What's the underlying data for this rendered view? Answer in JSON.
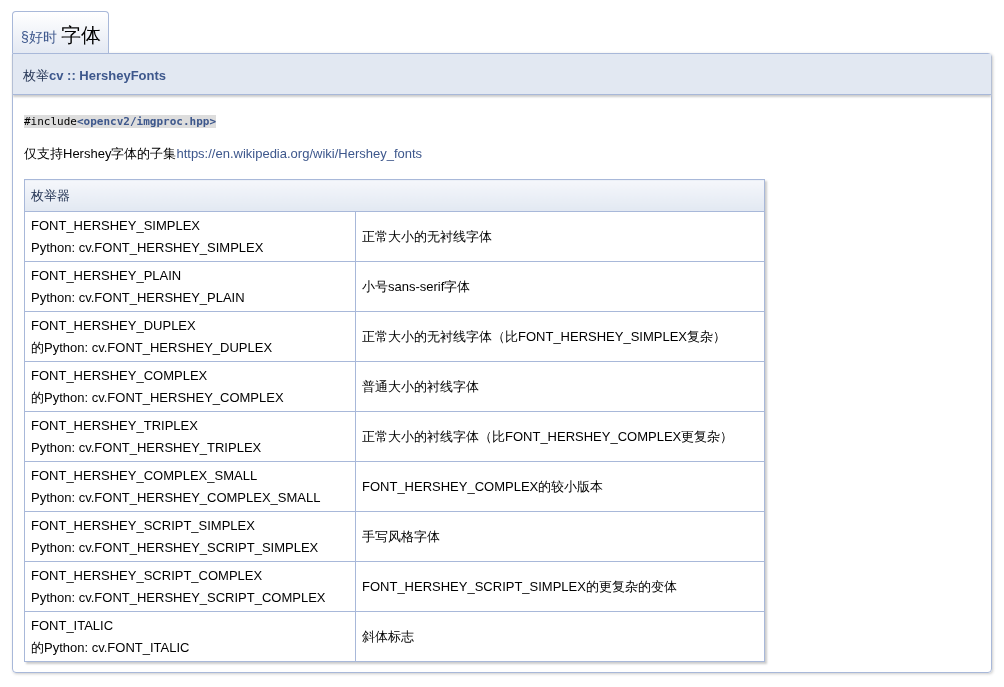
{
  "tab": {
    "prefix": "§好时",
    "title": "字体",
    "selected": true
  },
  "header": {
    "title": "枚举**cv :: HersheyFonts**"
  },
  "include": {
    "directive": "#include ",
    "file": "<opencv2/imgproc.hpp>"
  },
  "description": {
    "text": "仅支持Hershey字体的子集",
    "link": "https://en.wikipedia.org/wiki/Hershey_fonts"
  },
  "table": {
    "heading": "枚举器",
    "rows": [
      {
        "name": "FONT_HERSHEY_SIMPLEX",
        "python": "Python: cv.FONT_HERSHEY_SIMPLEX",
        "description": "正常大小的无衬线字体"
      },
      {
        "name": "FONT_HERSHEY_PLAIN",
        "python": "Python: cv.FONT_HERSHEY_PLAIN",
        "description": "小号sans-serif字体"
      },
      {
        "name": "FONT_HERSHEY_DUPLEX",
        "python": "的Python: cv.FONT_HERSHEY_DUPLEX",
        "description": "正常大小的无衬线字体（比FONT_HERSHEY_SIMPLEX复杂）"
      },
      {
        "name": "FONT_HERSHEY_COMPLEX",
        "python": "的Python: cv.FONT_HERSHEY_COMPLEX",
        "description": "普通大小的衬线字体"
      },
      {
        "name": "FONT_HERSHEY_TRIPLEX",
        "python": "Python: cv.FONT_HERSHEY_TRIPLEX",
        "description": "正常大小的衬线字体（比FONT_HERSHEY_COMPLEX更复杂）"
      },
      {
        "name": "FONT_HERSHEY_COMPLEX_SMALL",
        "python": "Python: cv.FONT_HERSHEY_COMPLEX_SMALL",
        "description": "FONT_HERSHEY_COMPLEX的较小版本"
      },
      {
        "name": "FONT_HERSHEY_SCRIPT_SIMPLEX",
        "python": "Python: cv.FONT_HERSHEY_SCRIPT_SIMPLEX",
        "description": "手写风格字体"
      },
      {
        "name": "FONT_HERSHEY_SCRIPT_COMPLEX",
        "python": "Python: cv.FONT_HERSHEY_SCRIPT_COMPLEX",
        "description": "FONT_HERSHEY_SCRIPT_SIMPLEX的更复杂的变体"
      },
      {
        "name": "FONT_ITALIC",
        "python": "的Python: cv.FONT_ITALIC",
        "description": "斜体标志"
      }
    ]
  }
}
